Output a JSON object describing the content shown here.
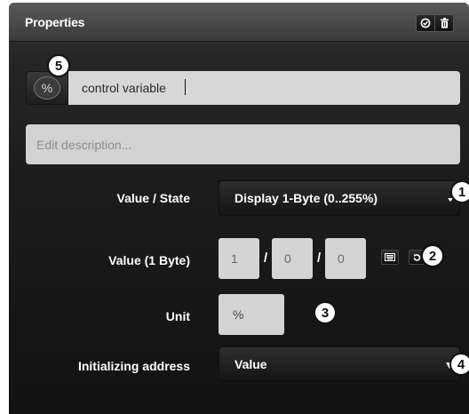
{
  "header": {
    "title": "Properties",
    "button_icons": [
      "check-circle-icon",
      "trash-icon"
    ]
  },
  "name_row": {
    "type_symbol": "%",
    "value": "control variable"
  },
  "description": {
    "placeholder": "Edit description..."
  },
  "value_state": {
    "label": "Value / State",
    "selected": "Display 1-Byte (0..255%)"
  },
  "value_1byte": {
    "label": "Value (1 Byte)",
    "fields": [
      "1",
      "0",
      "0"
    ],
    "separator": "/"
  },
  "unit": {
    "label": "Unit",
    "value": "%"
  },
  "initializing_address": {
    "label": "Initializing address",
    "selected": "Value"
  },
  "callouts": [
    "1",
    "2",
    "3",
    "4",
    "5"
  ],
  "colors": {
    "panel_dark": "#1c1c1c",
    "header": "#4a4a4a",
    "field_bg": "#d7d7d7",
    "label_text": "#ffffff"
  }
}
